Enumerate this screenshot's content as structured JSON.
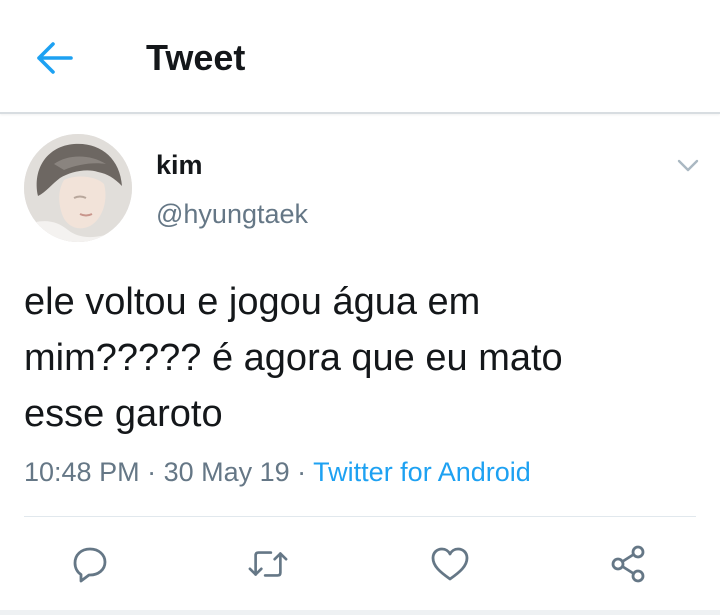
{
  "header": {
    "back_icon": "arrow-left-icon",
    "title": "Tweet"
  },
  "tweet": {
    "author": {
      "display_name": "kim",
      "handle": "@hyungtaek"
    },
    "text": "ele voltou e jogou água em\nmim????? é agora que eu mato\nesse garoto",
    "time": "10:48 PM",
    "date": "30 May 19",
    "separator": " · ",
    "source": "Twitter for Android"
  },
  "actions": {
    "icons": [
      "reply-icon",
      "retweet-icon",
      "like-icon",
      "share-icon"
    ]
  },
  "colors": {
    "accent": "#1da1f2",
    "text_primary": "#14171a",
    "text_secondary": "#657786",
    "icon_gray": "#657786",
    "divider": "#e1e8ed"
  }
}
